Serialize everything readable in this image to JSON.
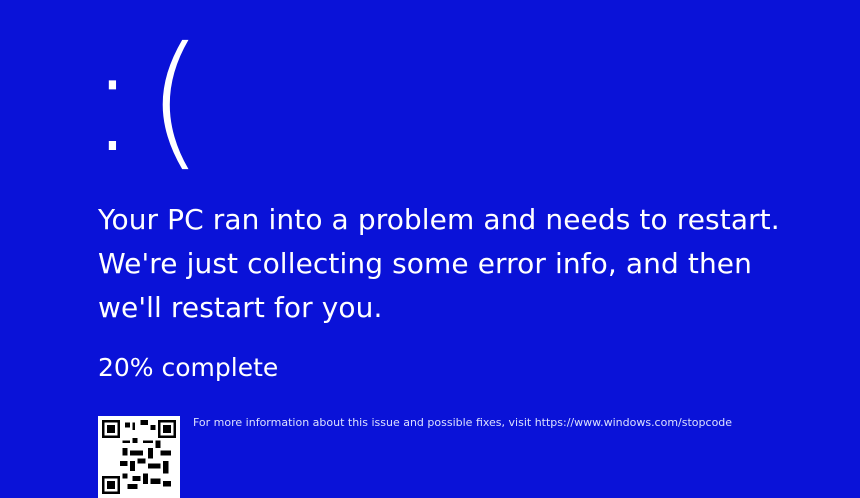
{
  "screen": {
    "face": ":(",
    "message": "Your PC ran into a problem and needs to restart. We're just collecting some error info, and then we'll restart for you.",
    "progress_text": "20% complete",
    "progress_percent": 20,
    "footer_text": "For more information about this issue and possible fixes, visit https://www.windows.com/stopcode"
  },
  "colors": {
    "background": "#0a12d8",
    "text": "#ffffff"
  },
  "icons": {
    "qr": "qr-code-icon"
  }
}
